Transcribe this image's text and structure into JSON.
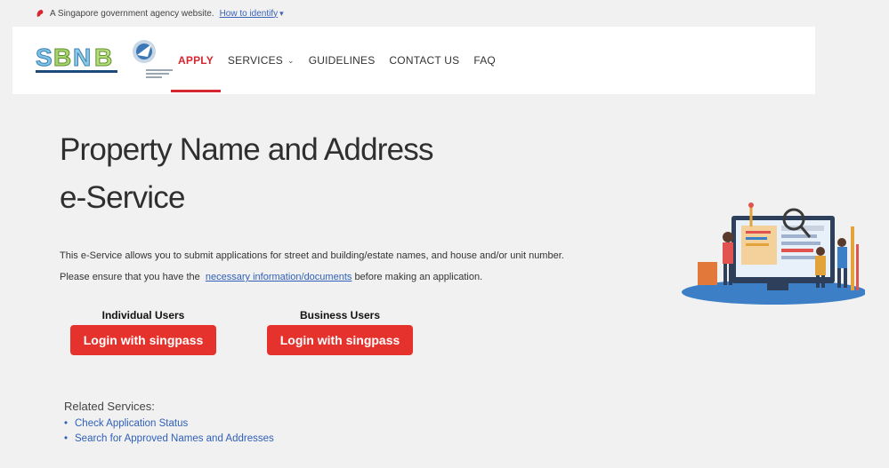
{
  "masthead": {
    "text": "A Singapore government agency website.",
    "link_label": "How to identify",
    "chevron": "▾"
  },
  "navbar": {
    "items": [
      {
        "label": "APPLY",
        "active": true
      },
      {
        "label": "SERVICES",
        "has_dropdown": true
      },
      {
        "label": "GUIDELINES"
      },
      {
        "label": "CONTACT US"
      },
      {
        "label": "FAQ"
      }
    ]
  },
  "hero": {
    "title_line1": "Property Name and Address",
    "title_line2": "e-Service",
    "desc_line1": "This e-Service allows you to submit applications for street and building/estate names, and house and/or unit number.",
    "desc_line2_prefix": "Please ensure that you have the",
    "desc_line2_link": "necessary information/documents",
    "desc_line2_suffix": "before making an application."
  },
  "login": {
    "individual_label": "Individual Users",
    "business_label": "Business Users",
    "button_label": "Login with singpass"
  },
  "related": {
    "heading": "Related Services:",
    "items": [
      "Check Application Status",
      "Search for Approved Names and Addresses"
    ]
  },
  "icons": {
    "masthead": "lion-head-icon",
    "dropdown": "chevron-down-icon"
  },
  "colors": {
    "accent_red": "#d6262f",
    "button_red": "#e5322d",
    "link_blue": "#2f5fb8",
    "page_bg": "#f1f1f1"
  }
}
